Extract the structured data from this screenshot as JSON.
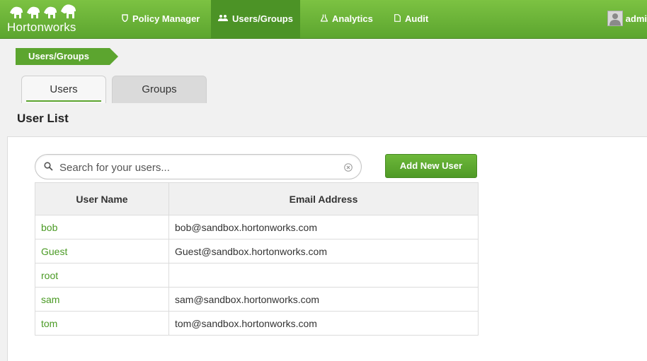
{
  "brand": {
    "logo_text": "Hortonworks"
  },
  "nav": [
    {
      "label": "Policy Manager",
      "icon": "shield-icon"
    },
    {
      "label": "Users/Groups",
      "icon": "users-icon",
      "active": true
    },
    {
      "label": "Analytics",
      "icon": "flask-icon"
    },
    {
      "label": "Audit",
      "icon": "document-icon"
    }
  ],
  "user_menu": {
    "label": "admi"
  },
  "breadcrumb": {
    "label": "Users/Groups"
  },
  "tabs": [
    {
      "label": "Users",
      "active": true
    },
    {
      "label": "Groups"
    }
  ],
  "page_title": "User List",
  "search": {
    "placeholder": "Search for your users..."
  },
  "add_button": "Add New User",
  "table": {
    "headers": [
      "User Name",
      "Email Address"
    ],
    "rows": [
      [
        "bob",
        "bob@sandbox.hortonworks.com"
      ],
      [
        "Guest",
        "Guest@sandbox.hortonworks.com"
      ],
      [
        "root",
        ""
      ],
      [
        "sam",
        "sam@sandbox.hortonworks.com"
      ],
      [
        "tom",
        "tom@sandbox.hortonworks.com"
      ]
    ]
  },
  "colors": {
    "brand_green": "#5ca52f",
    "link_green": "#4a9a24"
  }
}
